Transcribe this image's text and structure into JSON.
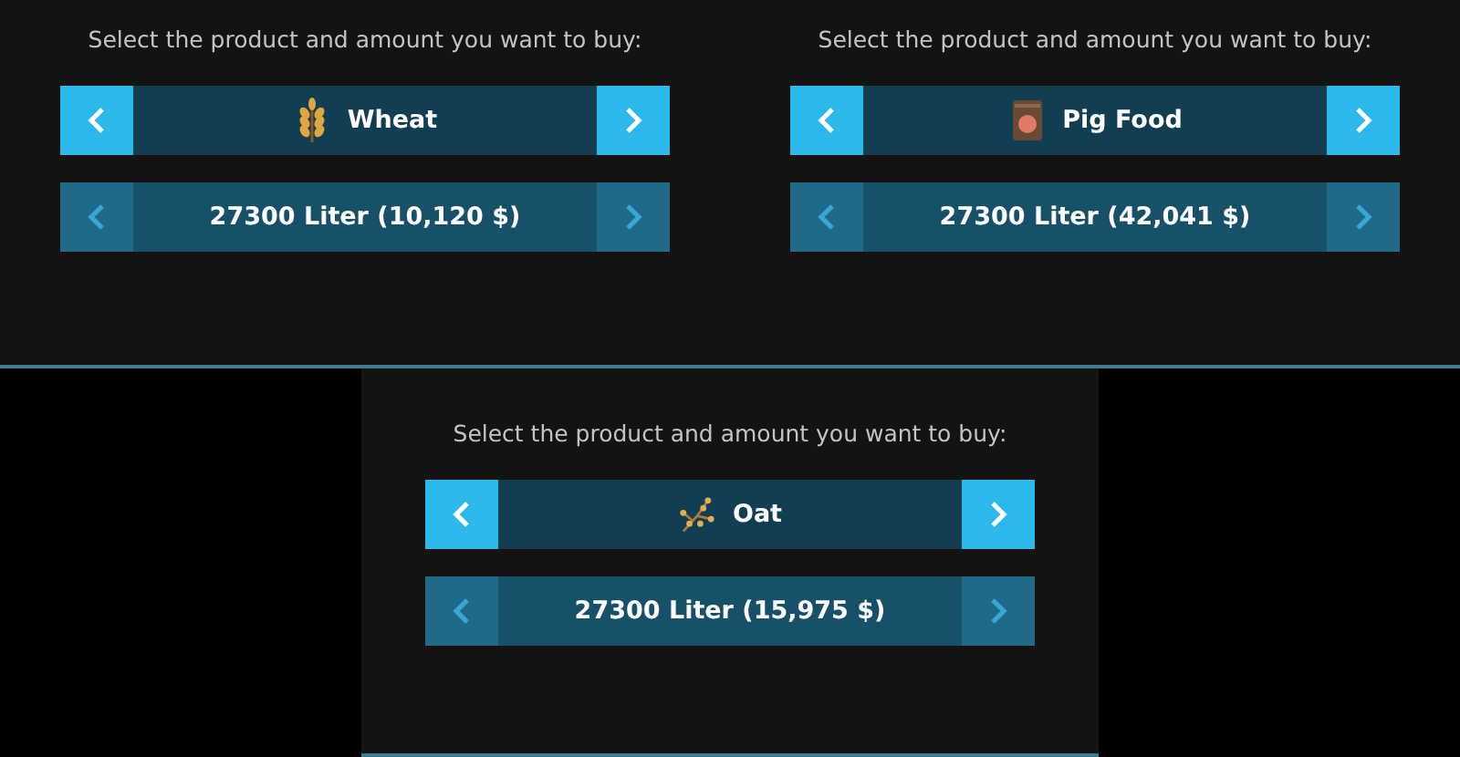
{
  "panels": [
    {
      "prompt": "Select the product and amount you want to buy:",
      "rows": [
        {
          "kind": "wheat",
          "label": "Wheat"
        },
        {
          "kind": "amount",
          "label": "27300 Liter (10,120 $)"
        }
      ]
    },
    {
      "prompt": "Select the product and amount you want to buy:",
      "rows": [
        {
          "kind": "feed",
          "label": "Pig Food"
        },
        {
          "kind": "amount",
          "label": "27300 Liter (42,041 $)"
        }
      ]
    },
    {
      "prompt": "Select the product and amount you want to buy:",
      "rows": [
        {
          "kind": "oat",
          "label": "Oat"
        },
        {
          "kind": "amount",
          "label": "27300 Liter (15,975 $)"
        }
      ]
    }
  ]
}
